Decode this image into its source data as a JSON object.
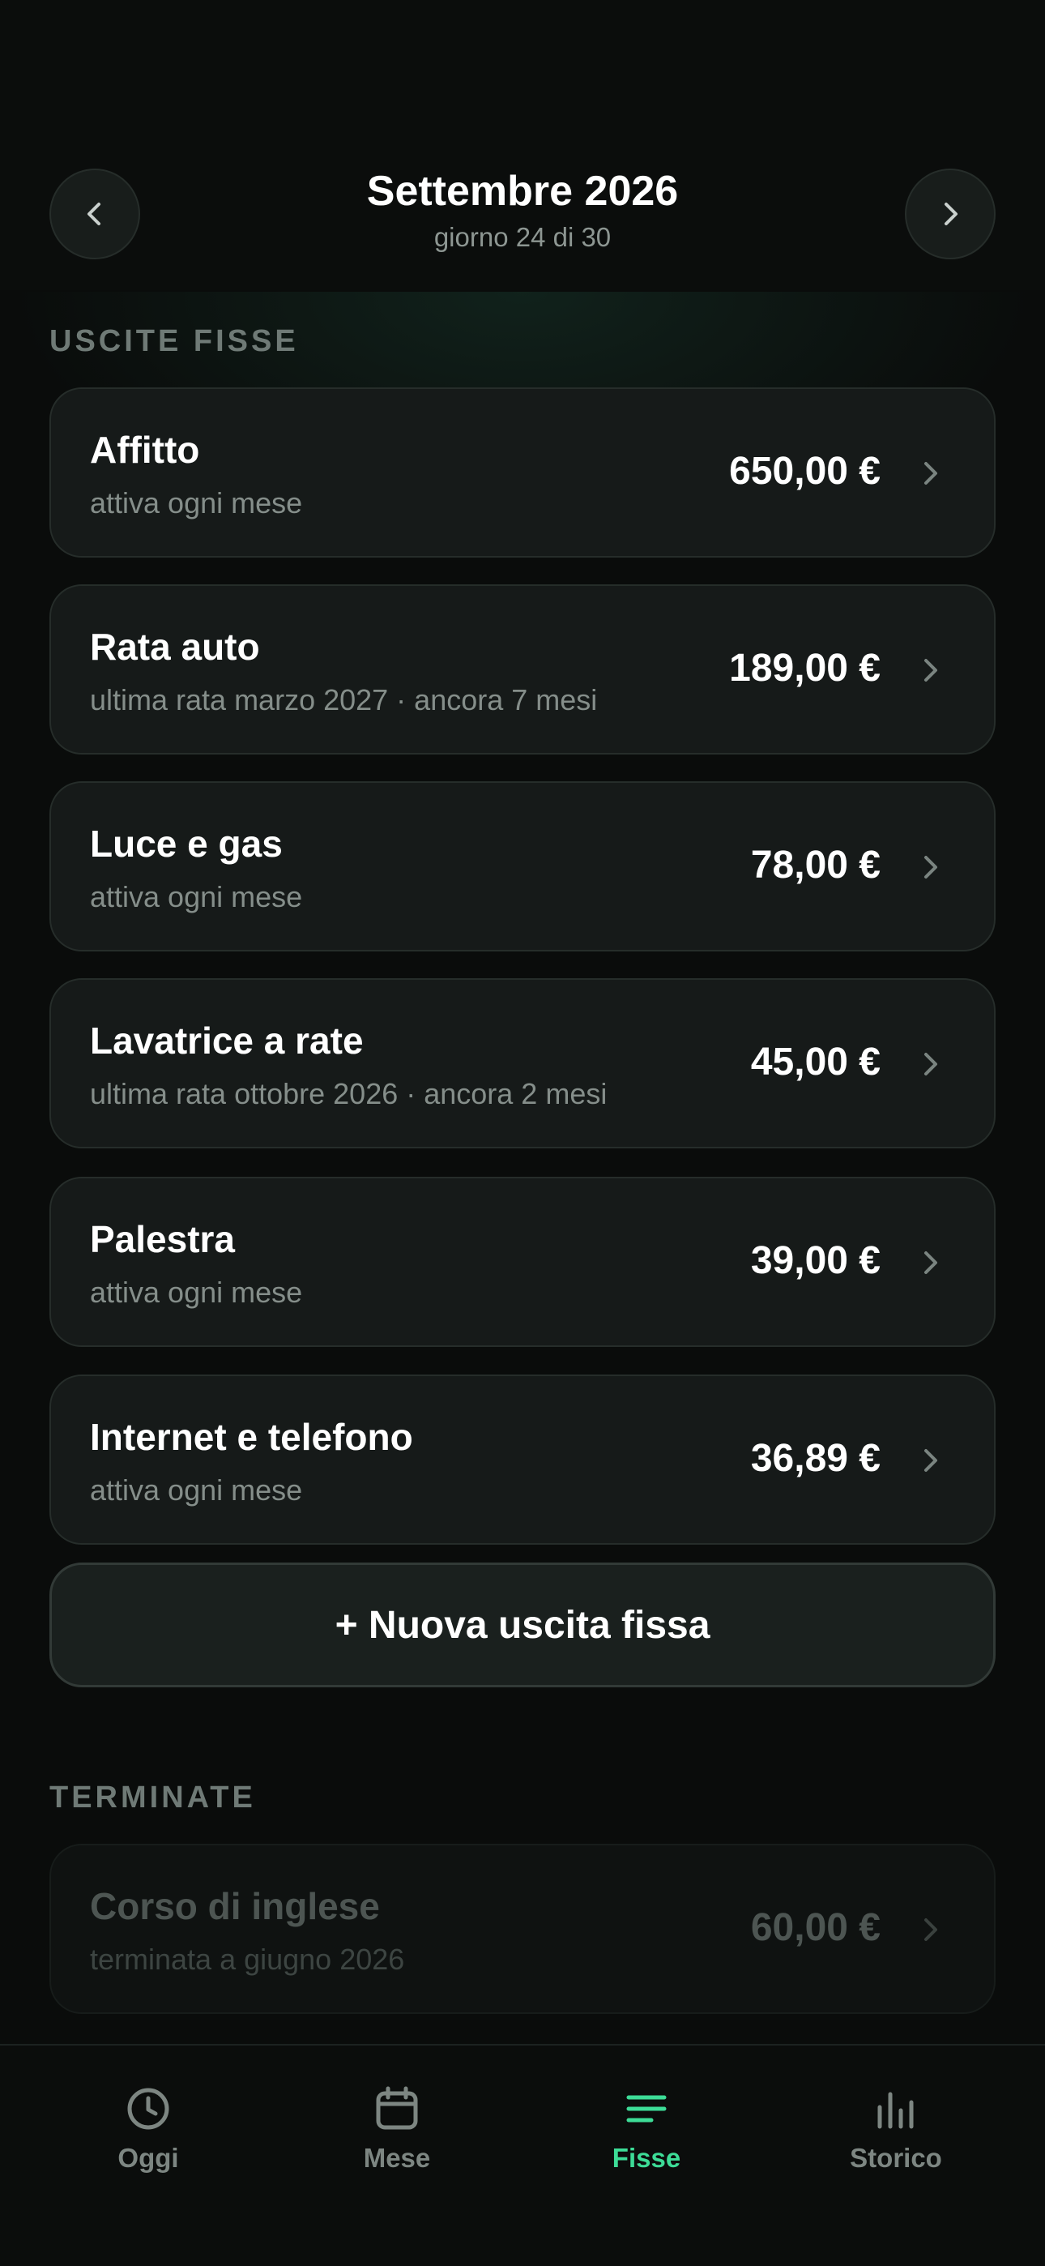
{
  "header": {
    "title": "Settembre 2026",
    "subtitle": "giorno 24 di 30",
    "prev_icon": "chevron-left-icon",
    "next_icon": "chevron-right-icon"
  },
  "fixed_section": {
    "label": "USCITE FISSE",
    "items": [
      {
        "name": "Affitto",
        "sub": "attiva ogni mese",
        "amount": "650,00 €"
      },
      {
        "name": "Rata auto",
        "sub": "ultima rata marzo 2027 · ancora 7 mesi",
        "amount": "189,00 €"
      },
      {
        "name": "Luce e gas",
        "sub": "attiva ogni mese",
        "amount": "78,00 €"
      },
      {
        "name": "Lavatrice a rate",
        "sub": "ultima rata ottobre 2026 · ancora 2 mesi",
        "amount": "45,00 €"
      },
      {
        "name": "Palestra",
        "sub": "attiva ogni mese",
        "amount": "39,00 €"
      },
      {
        "name": "Internet e telefono",
        "sub": "attiva ogni mese",
        "amount": "36,89 €"
      }
    ],
    "new_button": "+ Nuova uscita fissa"
  },
  "ended_section": {
    "label": "TERMINATE",
    "items": [
      {
        "name": "Corso di inglese",
        "sub": "terminata a giugno 2026",
        "amount": "60,00 €"
      }
    ]
  },
  "tabbar": {
    "tabs": [
      {
        "label": "Oggi",
        "icon": "clock-icon"
      },
      {
        "label": "Mese",
        "icon": "calendar-icon"
      },
      {
        "label": "Fisse",
        "icon": "list-icon",
        "active": true
      },
      {
        "label": "Storico",
        "icon": "bar-chart-icon"
      }
    ]
  },
  "colors": {
    "accent": "#3ddc97",
    "background": "#0a0c0b",
    "card": "#161a19",
    "muted_text": "#858e8a"
  }
}
